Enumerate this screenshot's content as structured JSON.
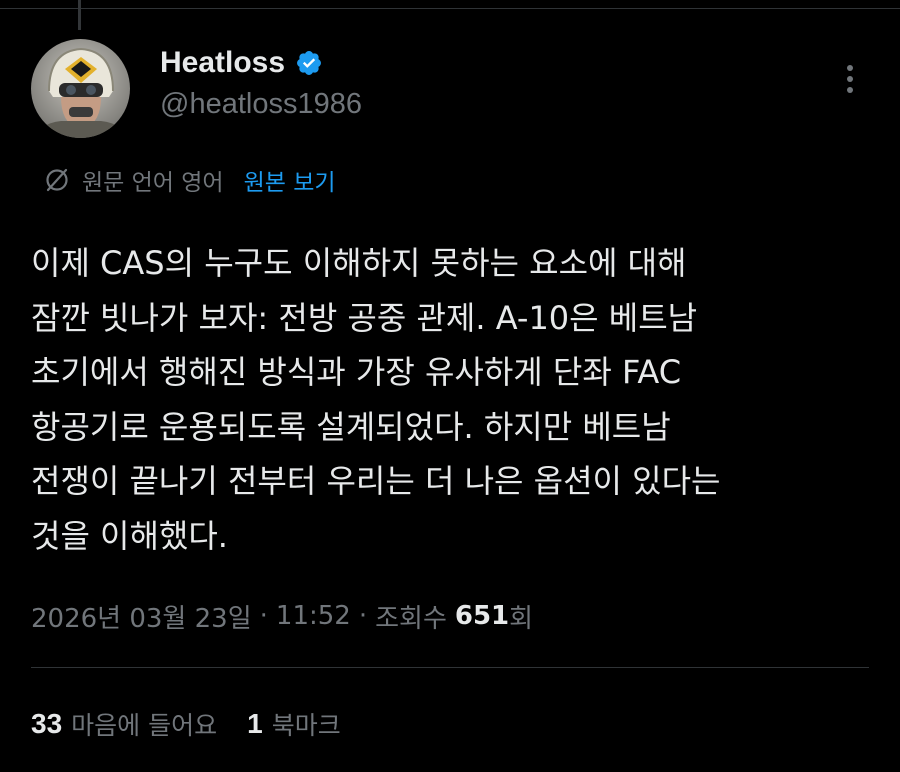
{
  "author": {
    "display_name": "Heatloss",
    "handle": "@heatloss1986",
    "verified": true
  },
  "translation": {
    "notice": "원문 언어 영어",
    "show_original_label": "원본 보기"
  },
  "tweet": {
    "lines": [
      "이제 CAS의 누구도 이해하지 못하는 요소에 대해",
      "잠깐 빗나가 보자: 전방 공중 관제. A-10은 베트남",
      "초기에서 행해진 방식과 가장 유사하게 단좌 FAC",
      "항공기로 운용되도록 설계되었다. 하지만 베트남",
      "전쟁이 끝나기 전부터 우리는 더 나은 옵션이 있다는",
      "것을 이해했다."
    ]
  },
  "meta": {
    "date": "2026년 03월 23일",
    "separator": "·",
    "time": "11:52",
    "views_label": "조회수",
    "views_count": "651",
    "views_suffix": "회"
  },
  "stats": {
    "likes_count": "33",
    "likes_label": "마음에 들어요",
    "bookmarks_count": "1",
    "bookmarks_label": "북마크"
  },
  "colors": {
    "background": "#000000",
    "text_primary": "#e7e9ea",
    "text_secondary": "#71767b",
    "accent": "#1d9bf0",
    "divider": "#2f3336"
  },
  "icons": {
    "verified": "verified-badge-icon",
    "more": "more-options-icon",
    "translate": "translate-icon"
  }
}
